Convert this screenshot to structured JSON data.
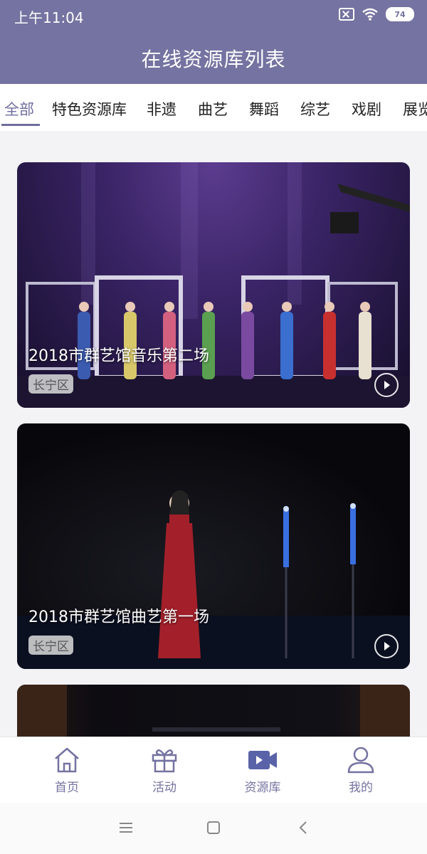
{
  "status_bar": {
    "time": "上午11:04",
    "battery": "74"
  },
  "header": {
    "title": "在线资源库列表"
  },
  "tabs": [
    {
      "label": "全部",
      "active": true
    },
    {
      "label": "特色资源库"
    },
    {
      "label": "非遗"
    },
    {
      "label": "曲艺"
    },
    {
      "label": "舞蹈"
    },
    {
      "label": "综艺"
    },
    {
      "label": "戏剧"
    },
    {
      "label": "展览"
    }
  ],
  "cards": [
    {
      "title": "2018市群艺馆音乐第二场",
      "tag": "长宁区"
    },
    {
      "title": "2018市群艺馆曲艺第一场",
      "tag": "长宁区"
    }
  ],
  "bottom_nav": [
    {
      "label": "首页",
      "icon": "home-icon"
    },
    {
      "label": "活动",
      "icon": "gift-icon"
    },
    {
      "label": "资源库",
      "icon": "video-camera-icon",
      "active": true
    },
    {
      "label": "我的",
      "icon": "user-icon"
    }
  ],
  "system_nav": [
    "menu-icon",
    "home-square-icon",
    "back-icon"
  ],
  "colors": {
    "accent": "#7473a1"
  }
}
